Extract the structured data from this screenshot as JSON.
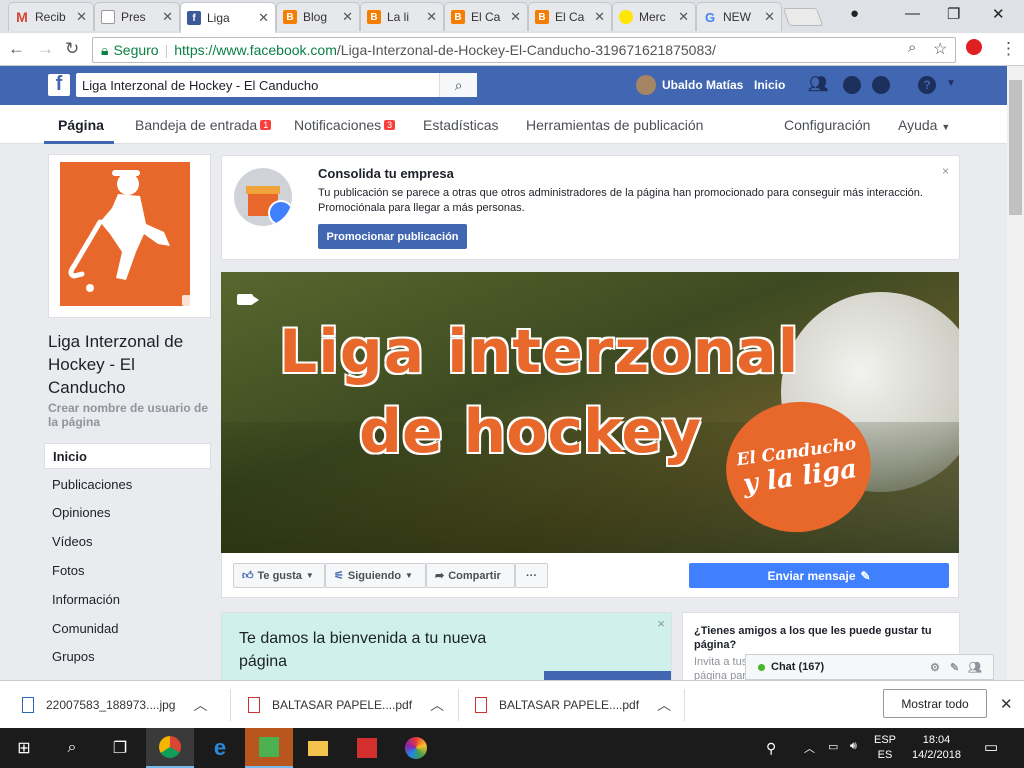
{
  "browser": {
    "tabs": [
      {
        "label": "Recib",
        "icon": "gmail-icon",
        "color": "#d44638"
      },
      {
        "label": "Pres",
        "icon": "doc-icon",
        "color": "#9e9e9e"
      },
      {
        "label": "Liga",
        "icon": "facebook-icon",
        "color": "#3b5998",
        "active": true
      },
      {
        "label": "Blog",
        "icon": "blogger-icon",
        "color": "#f57d00"
      },
      {
        "label": "La li",
        "icon": "blogger-icon",
        "color": "#f57d00"
      },
      {
        "label": "El Ca",
        "icon": "blogger-icon",
        "color": "#f57d00"
      },
      {
        "label": "El Ca",
        "icon": "blogger-icon",
        "color": "#f57d00"
      },
      {
        "label": "Merc",
        "icon": "mercadolibre-icon",
        "color": "#ffe600"
      },
      {
        "label": "NEW",
        "icon": "google-icon",
        "color": "#4285f4"
      }
    ],
    "secure_label": "Seguro",
    "url_host": "https://www.facebook.com",
    "url_path": "/Liga-Interzonal-de-Hockey-El-Canducho-319671621875083/"
  },
  "fb": {
    "search_value": "Liga Interzonal de Hockey - El Canducho",
    "user_name": "Ubaldo Matías",
    "home_label": "Inicio"
  },
  "page_tabs": {
    "pagina": "Página",
    "inbox": "Bandeja de entrada",
    "inbox_badge": "1",
    "notif": "Notificaciones",
    "notif_badge": "3",
    "stats": "Estadísticas",
    "tools": "Herramientas de publicación",
    "config": "Configuración",
    "help": "Ayuda"
  },
  "page": {
    "name": "Liga Interzonal de Hockey - El Canducho",
    "username_prompt": "Crear nombre de usuario de la página",
    "sidebar": [
      "Inicio",
      "Publicaciones",
      "Opiniones",
      "Vídeos",
      "Fotos",
      "Información",
      "Comunidad",
      "Grupos"
    ]
  },
  "promo": {
    "title": "Consolida tu empresa",
    "text": "Tu publicación se parece a otras que otros administradores de la página han promocionado para conseguir más interacción. Promociónala para llegar a más personas.",
    "button": "Promocionar publicación",
    "close": "×"
  },
  "cover": {
    "line1": "Liga interzonal",
    "line2": "de hockey",
    "badge1": "El Canducho",
    "badge2": "y la liga"
  },
  "actions": {
    "like": "Te gusta",
    "following": "Siguiendo",
    "share": "Compartir",
    "more": "···",
    "send_message": "Enviar mensaje"
  },
  "welcome": {
    "title": "Te damos la bienvenida a tu nueva página",
    "close": "×"
  },
  "friends": {
    "title": "¿Tienes amigos a los que les puede gustar tu página?",
    "sub1": "Invita a tus",
    "sub2": "página par"
  },
  "chat": {
    "label": "Chat (167)"
  },
  "downloads": {
    "items": [
      "22007583_188973....jpg",
      "BALTASAR PAPELE....pdf",
      "BALTASAR PAPELE....pdf"
    ],
    "show_all": "Mostrar todo"
  },
  "taskbar": {
    "lang1": "ESP",
    "lang2": "ES",
    "time": "18:04",
    "date": "14/2/2018"
  }
}
